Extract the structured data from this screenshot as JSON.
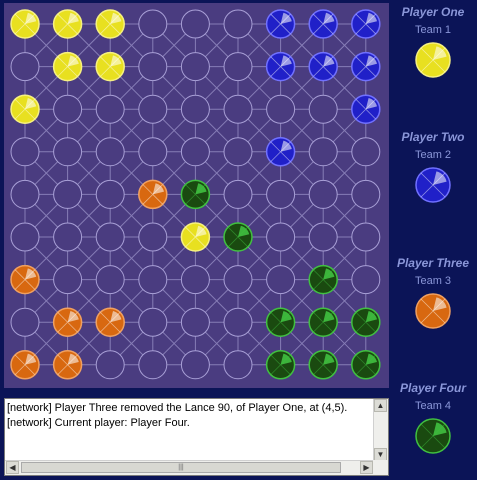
{
  "colors": {
    "board": "#4a3c80",
    "team1": "#e8e020",
    "team2": "#2020c8",
    "team3": "#d86810",
    "team4": "#1a4a10",
    "team4_accent": "#40c040"
  },
  "players": [
    {
      "name": "Player One",
      "team": "Team 1",
      "color_key": "team1"
    },
    {
      "name": "Player Two",
      "team": "Team 2",
      "color_key": "team2"
    },
    {
      "name": "Player Three",
      "team": "Team 3",
      "color_key": "team3"
    },
    {
      "name": "Player Four",
      "team": "Team 4",
      "color_key": "team4"
    }
  ],
  "board": {
    "cols": 9,
    "rows": 9,
    "pieces": [
      {
        "col": 0,
        "row": 0,
        "team": 1,
        "icon": "yellow-piece-icon"
      },
      {
        "col": 1,
        "row": 0,
        "team": 1,
        "icon": "yellow-piece-icon"
      },
      {
        "col": 2,
        "row": 0,
        "team": 1,
        "icon": "yellow-piece-icon"
      },
      {
        "col": 1,
        "row": 1,
        "team": 1,
        "icon": "yellow-piece-icon"
      },
      {
        "col": 2,
        "row": 1,
        "team": 1,
        "icon": "yellow-piece-icon"
      },
      {
        "col": 0,
        "row": 2,
        "team": 1,
        "icon": "yellow-piece-icon"
      },
      {
        "col": 4,
        "row": 5,
        "team": 1,
        "icon": "yellow-piece-icon"
      },
      {
        "col": 6,
        "row": 0,
        "team": 2,
        "icon": "blue-piece-icon"
      },
      {
        "col": 7,
        "row": 0,
        "team": 2,
        "icon": "blue-piece-icon"
      },
      {
        "col": 8,
        "row": 0,
        "team": 2,
        "icon": "blue-piece-icon"
      },
      {
        "col": 6,
        "row": 1,
        "team": 2,
        "icon": "blue-piece-icon"
      },
      {
        "col": 7,
        "row": 1,
        "team": 2,
        "icon": "blue-piece-icon"
      },
      {
        "col": 8,
        "row": 1,
        "team": 2,
        "icon": "blue-piece-icon"
      },
      {
        "col": 8,
        "row": 2,
        "team": 2,
        "icon": "blue-piece-icon"
      },
      {
        "col": 6,
        "row": 3,
        "team": 2,
        "icon": "blue-piece-icon"
      },
      {
        "col": 3,
        "row": 4,
        "team": 3,
        "icon": "orange-piece-icon"
      },
      {
        "col": 0,
        "row": 6,
        "team": 3,
        "icon": "orange-piece-icon"
      },
      {
        "col": 1,
        "row": 7,
        "team": 3,
        "icon": "orange-piece-icon"
      },
      {
        "col": 2,
        "row": 7,
        "team": 3,
        "icon": "orange-piece-icon"
      },
      {
        "col": 0,
        "row": 8,
        "team": 3,
        "icon": "orange-piece-icon"
      },
      {
        "col": 1,
        "row": 8,
        "team": 3,
        "icon": "orange-piece-icon"
      },
      {
        "col": 4,
        "row": 4,
        "team": 4,
        "icon": "green-piece-icon"
      },
      {
        "col": 5,
        "row": 5,
        "team": 4,
        "icon": "green-piece-icon"
      },
      {
        "col": 7,
        "row": 6,
        "team": 4,
        "icon": "green-piece-icon"
      },
      {
        "col": 6,
        "row": 7,
        "team": 4,
        "icon": "green-piece-icon"
      },
      {
        "col": 7,
        "row": 7,
        "team": 4,
        "icon": "green-piece-icon"
      },
      {
        "col": 8,
        "row": 7,
        "team": 4,
        "icon": "green-piece-icon"
      },
      {
        "col": 6,
        "row": 8,
        "team": 4,
        "icon": "green-piece-icon"
      },
      {
        "col": 7,
        "row": 8,
        "team": 4,
        "icon": "green-piece-icon"
      },
      {
        "col": 8,
        "row": 8,
        "team": 4,
        "icon": "green-piece-icon"
      }
    ]
  },
  "log": {
    "lines": [
      "[network] Player Three removed the Lance 90, of Player One, at (4,5).",
      "[network] Current player: Player Four."
    ]
  }
}
